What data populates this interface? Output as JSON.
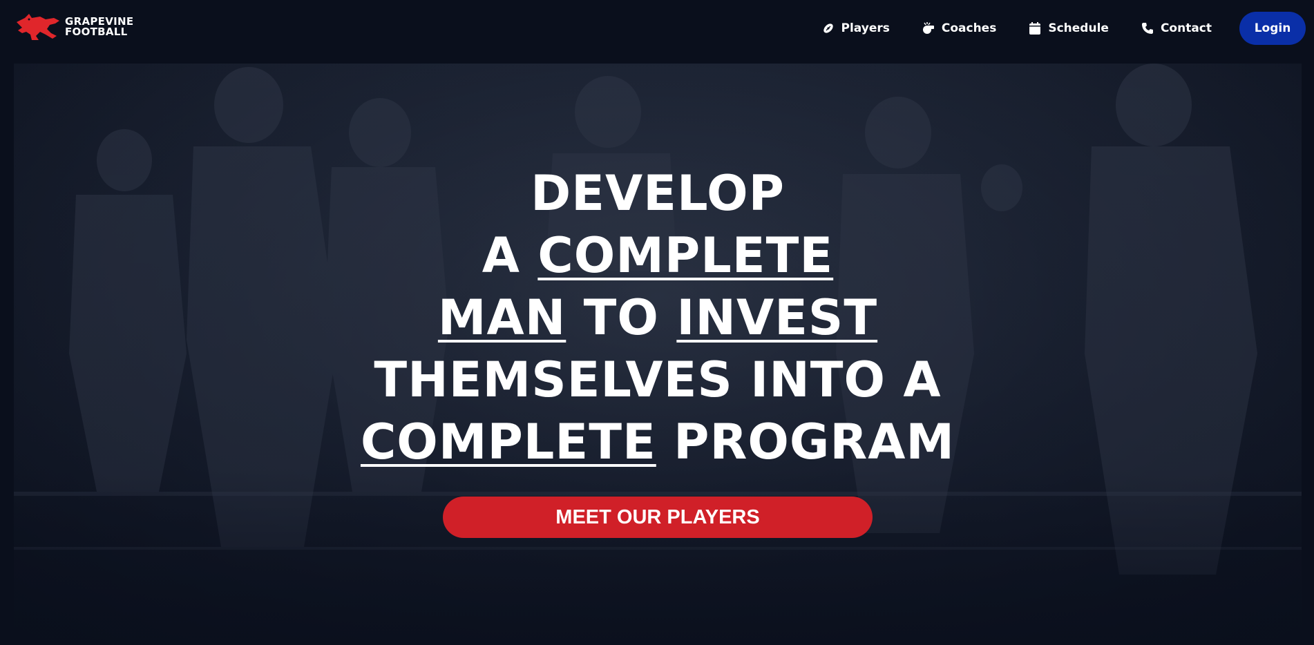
{
  "brand": {
    "line1": "GRAPEVINE",
    "line2": "FOOTBALL",
    "color": "#e0262b"
  },
  "nav": {
    "items": [
      {
        "label": "Players",
        "icon": "football-icon"
      },
      {
        "label": "Coaches",
        "icon": "whistle-icon"
      },
      {
        "label": "Schedule",
        "icon": "calendar-icon"
      },
      {
        "label": "Contact",
        "icon": "phone-icon"
      }
    ],
    "login_label": "Login"
  },
  "hero": {
    "line1": [
      "DEVELOP"
    ],
    "line2": [
      "A ",
      "COMPLETE"
    ],
    "line3": [
      "MAN",
      " TO ",
      "INVEST"
    ],
    "line4": [
      "THEMSELVES INTO A"
    ],
    "line5": [
      "COMPLETE",
      " PROGRAM"
    ],
    "cta_label": "MEET OUR PLAYERS"
  },
  "colors": {
    "background": "#0a0f1c",
    "login": "#0a2fa8",
    "cta": "#d02028"
  }
}
